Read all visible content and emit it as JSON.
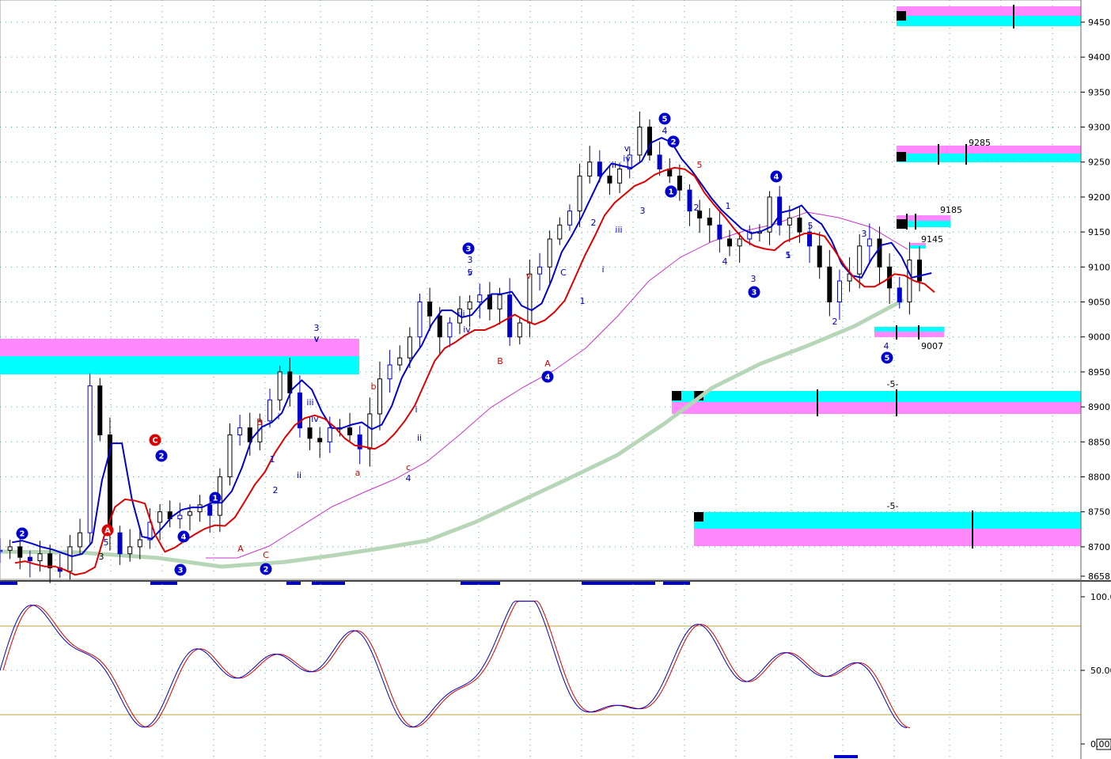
{
  "chart_data": [
    {
      "type": "candlestick",
      "panel": "price",
      "ylim": [
        8658,
        9480
      ],
      "y_ticks": [
        "9450",
        "9400",
        "9350",
        "9300",
        "9250",
        "9200",
        "9150",
        "9100",
        "9050",
        "9000",
        "8950",
        "8900",
        "8850",
        "8800",
        "8750",
        "8700",
        "8658"
      ],
      "grid": true,
      "price_path": [
        8695,
        8700,
        8685,
        8680,
        8690,
        8670,
        8665,
        8700,
        8720,
        8930,
        8860,
        8720,
        8690,
        8700,
        8710,
        8735,
        8750,
        8740,
        8745,
        8750,
        8760,
        8745,
        8800,
        8860,
        8870,
        8850,
        8880,
        8910,
        8950,
        8920,
        8870,
        8855,
        8850,
        8870,
        8870,
        8860,
        8840,
        8890,
        8940,
        8960,
        8970,
        9000,
        9050,
        9030,
        9000,
        9020,
        9040,
        9050,
        9060,
        9040,
        9060,
        9000,
        9020,
        9090,
        9100,
        9140,
        9160,
        9180,
        9230,
        9250,
        9230,
        9220,
        9240,
        9260,
        9300,
        9260,
        9240,
        9230,
        9210,
        9180,
        9170,
        9160,
        9140,
        9130,
        9140,
        9150,
        9150,
        9200,
        9160,
        9170,
        9150,
        9130,
        9100,
        9050,
        9080,
        9090,
        9130,
        9140,
        9100,
        9070,
        9050,
        9110,
        9080
      ],
      "overlays": [
        {
          "name": "fast-band-blue",
          "color": "#0000cc"
        },
        {
          "name": "fast-band-red",
          "color": "#dd0000"
        },
        {
          "name": "ma-magenta",
          "color": "#cc33cc"
        },
        {
          "name": "ma-long-green",
          "color": "#b7d6b7"
        }
      ],
      "target_zones": [
        {
          "level_label": "",
          "colors": [
            "#ff88ff",
            "#00ffff"
          ]
        },
        {
          "level_label": "9285",
          "colors": [
            "#ff88ff",
            "#00ffff"
          ]
        },
        {
          "level_label": "9185",
          "colors": [
            "#ff88ff",
            "#00ffff"
          ]
        },
        {
          "level_label": "9145",
          "colors": [
            "#ff88ff",
            "#00ffff"
          ]
        },
        {
          "level_label": "9007",
          "colors": [
            "#00ffff",
            "#ff88ff"
          ]
        },
        {
          "level_label": "-5-",
          "colors": [
            "#00ffff",
            "#ff88ff"
          ]
        },
        {
          "level_label": "-5-",
          "colors": [
            "#00ffff",
            "#ff88ff"
          ]
        },
        {
          "level_label": "",
          "colors": [
            "#ff88ff",
            "#00ffff"
          ]
        }
      ],
      "wave_labels": {
        "circled": [
          "2",
          "A",
          "C",
          "2",
          "1",
          "4",
          "3",
          "1",
          "2",
          "3",
          "4",
          "5",
          "2",
          "1",
          "4",
          "3",
          "5"
        ],
        "plain": [
          "3",
          "5",
          "B",
          "A",
          "C",
          "1",
          "2",
          "i",
          "ii",
          "iii",
          "iv",
          "v",
          "3",
          "v",
          "b",
          "a",
          "c",
          "4",
          "i",
          "ii",
          "iii",
          "iv",
          "v",
          "3",
          "5",
          "v",
          "B",
          "A",
          "C",
          "1",
          "2",
          "i",
          "ii",
          "iii",
          "iv",
          "v",
          "3",
          "4",
          "5",
          "2",
          "1",
          "4",
          "3",
          "5",
          "2",
          "3",
          "4",
          "5",
          "1",
          "i"
        ]
      }
    },
    {
      "type": "line",
      "panel": "oscillator",
      "ylim": [
        0,
        100
      ],
      "y_ticks": [
        "100.0",
        "50.00",
        "0.00"
      ],
      "series": [
        {
          "color": "#0000cc"
        },
        {
          "color": "#dd0000"
        }
      ]
    }
  ]
}
